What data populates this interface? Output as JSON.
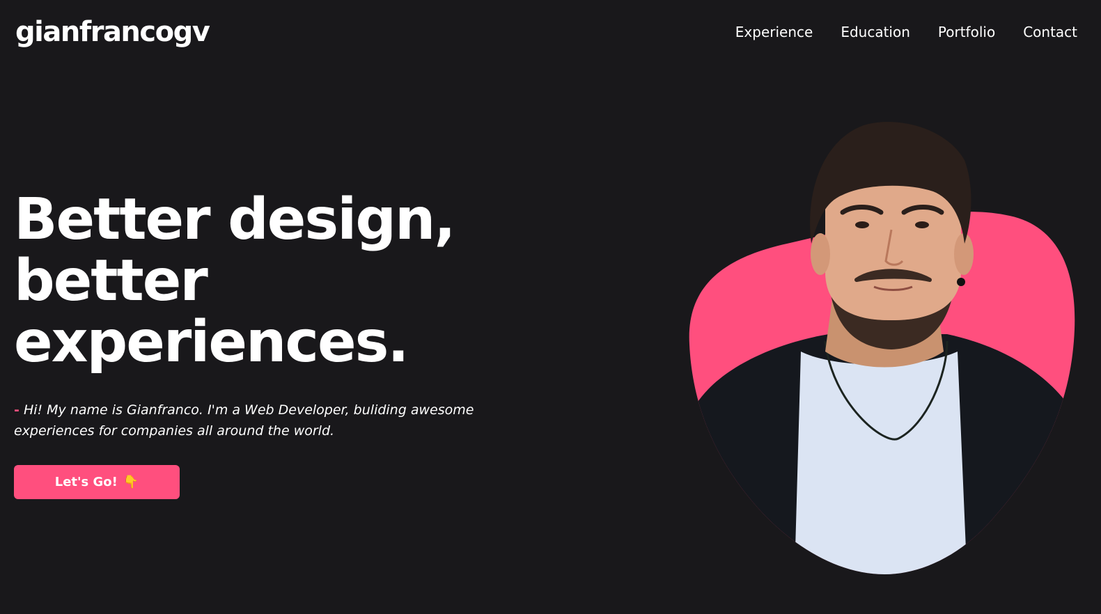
{
  "header": {
    "logo_text": "gianfrancogv",
    "nav": [
      {
        "label": "Experience"
      },
      {
        "label": "Education"
      },
      {
        "label": "Portfolio"
      },
      {
        "label": "Contact"
      }
    ]
  },
  "hero": {
    "headline_lines": [
      "Better design,",
      "better",
      "experiences."
    ],
    "intro_dash": "-",
    "intro_text": "Hi! My name is Gianfranco. I'm a Web Developer, buliding awesome experiences for companies all around the world.",
    "cta_label": "Let's Go!",
    "cta_icon": "pointing-down-hand-icon"
  },
  "colors": {
    "background": "#19181b",
    "accent": "#ff4f7e",
    "text": "#ffffff"
  }
}
